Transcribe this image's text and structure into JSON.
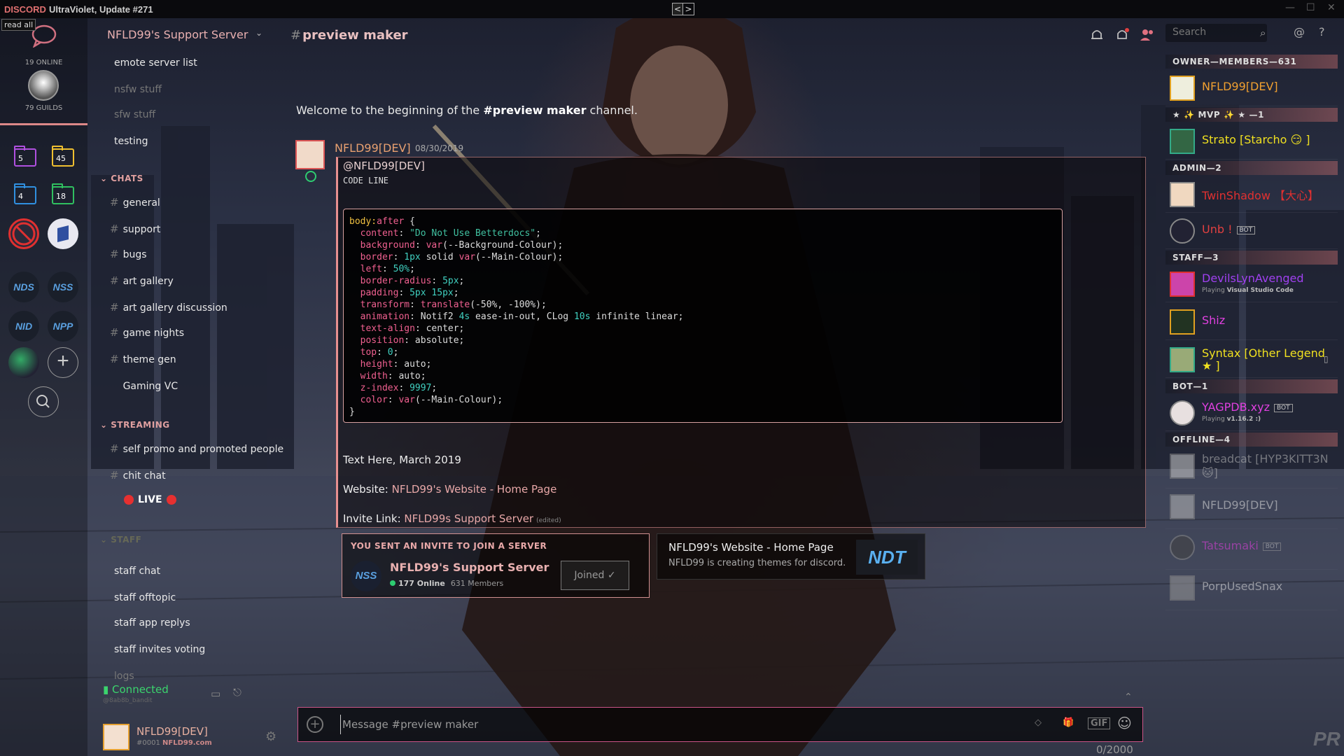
{
  "titlebar": {
    "brand": "DISCORD",
    "version": "UltraViolet, Update #271"
  },
  "read_all": "read all",
  "guilds": {
    "online": "19 ONLINE",
    "guild_count": "79 GUILDS",
    "folders": [
      {
        "count": "5",
        "color": "#b050e0"
      },
      {
        "count": "45",
        "color": "#f0c030"
      },
      {
        "count": "4",
        "color": "#3090e0"
      },
      {
        "count": "18",
        "color": "#30c060"
      }
    ],
    "servers": [
      "NDS",
      "NSS",
      "NID",
      "NPP"
    ]
  },
  "channels": {
    "server_name": "NFLD99's Support Server",
    "top": [
      {
        "name": "emote server list",
        "dim": false
      },
      {
        "name": "nsfw stuff",
        "dim": true
      },
      {
        "name": "sfw stuff",
        "dim": true
      },
      {
        "name": "testing",
        "dim": false
      }
    ],
    "cat_chats": "CHATS",
    "chats": [
      "general",
      "support",
      "bugs",
      "art gallery",
      "art gallery discussion",
      "game nights",
      "theme gen",
      "Gaming VC"
    ],
    "cat_streaming": "STREAMING",
    "streaming": [
      "self promo and promoted people",
      "chit chat"
    ],
    "live": "LIVE",
    "cat_staff": "STAFF",
    "staff": [
      "staff chat",
      "staff offtopic",
      "staff app replys",
      "staff invites voting",
      "logs"
    ],
    "connected": "Connected",
    "connected_sub": "@8ab8b_bandit"
  },
  "user": {
    "name": "NFLD99[DEV]",
    "tag": "#0001",
    "site": "NFLD99.com"
  },
  "header": {
    "channel": "preview maker",
    "search_placeholder": "Search"
  },
  "chat": {
    "welcome_prefix": "Welcome to the beginning of the ",
    "welcome_channel": "#preview maker",
    "welcome_suffix": " channel.",
    "author": "NFLD99[DEV]",
    "timestamp": "08/30/2019",
    "mention": "@NFLD99[DEV]",
    "code_line": "CODE LINE",
    "text1": "Text Here, March 2019",
    "website_label": "Website: ",
    "website_link": "NFLD99's Website - Home Page",
    "invite_label": "Invite Link: ",
    "invite_link": "NFLD99s Support Server",
    "edited": "(edited)"
  },
  "invite": {
    "header": "YOU SENT AN INVITE TO JOIN A SERVER",
    "icon": "NSS",
    "server": "NFLD99's Support Server",
    "online": "177 Online",
    "members": "631 Members",
    "joined": "Joined"
  },
  "embed": {
    "title": "NFLD99's Website - Home Page",
    "description": "NFLD99 is creating themes for discord.",
    "logo": "NDT"
  },
  "composer": {
    "placeholder": "Message #preview maker",
    "count": "0/2000",
    "gif": "GIF"
  },
  "members": {
    "owner_cat": "OWNER—MEMBERS—631",
    "mvp_cat": "★ ✨ MVP ✨ ★ —1",
    "admin_cat": "ADMIN—2",
    "staff_cat": "STAFF—3",
    "bot_cat": "BOT—1",
    "offline_cat": "OFFLINE—4",
    "owner": {
      "name": "NFLD99[DEV]",
      "color": "#f0a030"
    },
    "mvp": {
      "name": "Strato [Starcho 😏 ]",
      "color": "#f0e020"
    },
    "admin": [
      {
        "name": "TwinShadow 【大心】",
        "color": "#e03030",
        "bot": ""
      },
      {
        "name": "Unb !",
        "color": "#e04040",
        "bot": "BOT"
      }
    ],
    "staff": [
      {
        "name": "DevilsLynAvenged",
        "color": "#a040f0",
        "status_pre": "Playing ",
        "status": "Visual Studio Code"
      },
      {
        "name": "Shiz",
        "color": "#e040e0",
        "status_pre": "",
        "status": ""
      },
      {
        "name": "Syntax [Other Legend ★ ]",
        "color": "#f0e020",
        "status_pre": "",
        "status": ""
      }
    ],
    "bot": {
      "name": "YAGPDB.xyz",
      "color": "#e040e0",
      "tag": "BOT",
      "status_pre": "Playing ",
      "status": "v1.16.2 :)"
    },
    "offline": [
      {
        "name": "breadcat [HYP3KITT3N 🐱]",
        "bot": ""
      },
      {
        "name": "NFLD99[DEV]",
        "bot": ""
      },
      {
        "name": "Tatsumaki",
        "bot": "BOT"
      },
      {
        "name": "PorpUsedSnax",
        "bot": ""
      }
    ]
  }
}
